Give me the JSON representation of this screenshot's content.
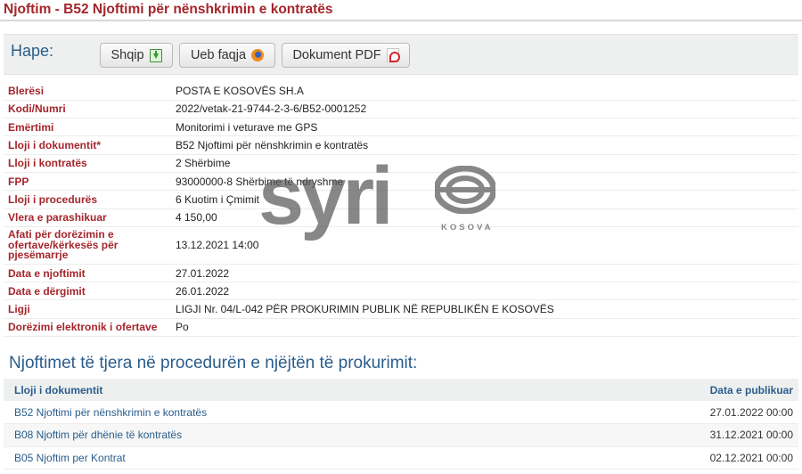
{
  "page_title": "Njoftim - B52 Njoftimi për nënshkrimin e kontratës",
  "open_section": {
    "label": "Hape:",
    "buttons": [
      {
        "label": "Shqip",
        "icon": "download-icon"
      },
      {
        "label": "Ueb faqja",
        "icon": "firefox-icon"
      },
      {
        "label": "Dokument PDF",
        "icon": "pdf-icon"
      }
    ]
  },
  "details": [
    {
      "key": "Blerësi",
      "value": "POSTA E KOSOVËS SH.A"
    },
    {
      "key": "Kodi/Numri",
      "value": "2022/vetak-21-9744-2-3-6/B52-0001252"
    },
    {
      "key": "Emërtimi",
      "value": "Monitorimi i veturave me GPS"
    },
    {
      "key": "Lloji i dokumentit*",
      "value": "B52 Njoftimi për nënshkrimin e kontratës"
    },
    {
      "key": "Lloji i kontratës",
      "value": "2 Shërbime"
    },
    {
      "key": "FPP",
      "value": "93000000-8 Shërbime të ndryshme"
    },
    {
      "key": "Lloji i procedurës",
      "value": "6 Kuotim i Çmimit"
    },
    {
      "key": "Vlera e parashikuar",
      "value": "4 150,00"
    },
    {
      "key": "Afati për dorëzimin e ofertave/kërkesës për pjesëmarrje",
      "value": "13.12.2021 14:00"
    },
    {
      "key": "Data e njoftimit",
      "value": "27.01.2022"
    },
    {
      "key": "Data e dërgimit",
      "value": "26.01.2022"
    },
    {
      "key": "Ligji",
      "value": "LIGJI Nr. 04/L-042 PËR PROKURIMIN PUBLIK NË REPUBLIKËN E KOSOVËS"
    },
    {
      "key": "Dorëzimi elektronik i ofertave",
      "value": "Po"
    }
  ],
  "watermark": {
    "text": "syri",
    "sub": "KOSOVA"
  },
  "other_notices": {
    "title": "Njoftimet të tjera në procedurën e njëjtën të prokurimit:",
    "headers": {
      "doc_type": "Lloji i dokumentit",
      "published": "Data e publikuar"
    },
    "rows": [
      {
        "doc": "B52 Njoftimi për nënshkrimin e kontratës",
        "date": "27.01.2022 00:00"
      },
      {
        "doc": "B08 Njoftim për dhënie të kontratës",
        "date": "31.12.2021 00:00"
      },
      {
        "doc": "B05 Njoftim per Kontrat",
        "date": "02.12.2021 00:00"
      }
    ]
  },
  "colors": {
    "label_red": "#a4262c",
    "heading_blue": "#2a5d8c",
    "panel_gray": "#eef0ef"
  }
}
